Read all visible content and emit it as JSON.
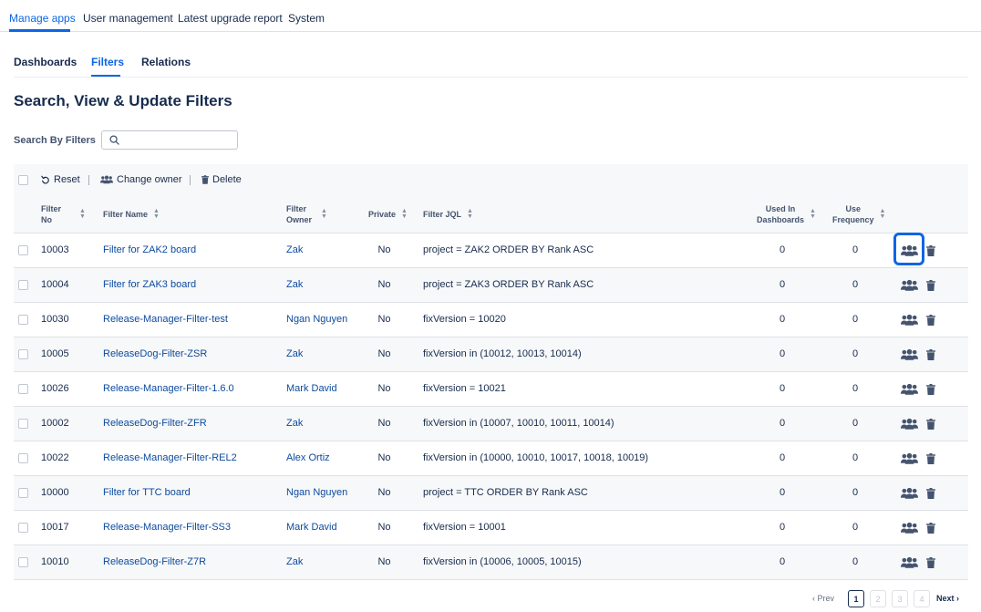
{
  "top_nav": {
    "tabs": [
      "Manage apps",
      "User management",
      "Latest upgrade report",
      "System"
    ],
    "active": "Manage apps"
  },
  "sub_nav": {
    "tabs": [
      "Dashboards",
      "Filters",
      "Relations"
    ],
    "active": "Filters"
  },
  "page_title": "Search, View & Update Filters",
  "search": {
    "label": "Search By Filters",
    "value": "",
    "placeholder": ""
  },
  "toolbar": {
    "reset": "Reset",
    "change_owner": "Change owner",
    "delete": "Delete"
  },
  "table": {
    "headers": {
      "filter_no": [
        "Filter",
        "No"
      ],
      "filter_name": "Filter Name",
      "filter_owner": [
        "Filter",
        "Owner"
      ],
      "private": "Private",
      "filter_jql": "Filter JQL",
      "used_in_dashboards": [
        "Used In",
        "Dashboards"
      ],
      "use_frequency": [
        "Use",
        "Frequency"
      ]
    },
    "rows": [
      {
        "no": "10003",
        "name": "Filter for ZAK2 board",
        "owner": "Zak",
        "private": "No",
        "jql": "project = ZAK2 ORDER BY Rank ASC",
        "dashboards": "0",
        "frequency": "0"
      },
      {
        "no": "10004",
        "name": "Filter for ZAK3 board",
        "owner": "Zak",
        "private": "No",
        "jql": "project = ZAK3 ORDER BY Rank ASC",
        "dashboards": "0",
        "frequency": "0"
      },
      {
        "no": "10030",
        "name": "Release-Manager-Filter-test",
        "owner": "Ngan Nguyen",
        "private": "No",
        "jql": "fixVersion = 10020",
        "dashboards": "0",
        "frequency": "0"
      },
      {
        "no": "10005",
        "name": "ReleaseDog-Filter-ZSR",
        "owner": "Zak",
        "private": "No",
        "jql": "fixVersion in (10012, 10013, 10014)",
        "dashboards": "0",
        "frequency": "0"
      },
      {
        "no": "10026",
        "name": "Release-Manager-Filter-1.6.0",
        "owner": "Mark David",
        "private": "No",
        "jql": "fixVersion = 10021",
        "dashboards": "0",
        "frequency": "0"
      },
      {
        "no": "10002",
        "name": "ReleaseDog-Filter-ZFR",
        "owner": "Zak",
        "private": "No",
        "jql": "fixVersion in (10007, 10010, 10011, 10014)",
        "dashboards": "0",
        "frequency": "0"
      },
      {
        "no": "10022",
        "name": "Release-Manager-Filter-REL2",
        "owner": "Alex Ortiz",
        "private": "No",
        "jql": "fixVersion in (10000, 10010, 10017, 10018, 10019)",
        "dashboards": "0",
        "frequency": "0"
      },
      {
        "no": "10000",
        "name": "Filter for TTC board",
        "owner": "Ngan Nguyen",
        "private": "No",
        "jql": "project = TTC ORDER BY Rank ASC",
        "dashboards": "0",
        "frequency": "0"
      },
      {
        "no": "10017",
        "name": "Release-Manager-Filter-SS3",
        "owner": "Mark David",
        "private": "No",
        "jql": "fixVersion = 10001",
        "dashboards": "0",
        "frequency": "0"
      },
      {
        "no": "10010",
        "name": "ReleaseDog-Filter-Z7R",
        "owner": "Zak",
        "private": "No",
        "jql": "fixVersion in (10006, 10005, 10015)",
        "dashboards": "0",
        "frequency": "0"
      }
    ]
  },
  "pagination": {
    "prev": "Prev",
    "next": "Next",
    "pages": [
      "1",
      "2",
      "3",
      "4"
    ],
    "current": "1"
  },
  "colors": {
    "accent": "#0c66e4",
    "link": "#0c4a9e",
    "text": "#172b4d",
    "icon": "#44546f"
  },
  "icons": {
    "reset": "undo-icon",
    "change_owner": "users-icon",
    "delete": "trash-icon",
    "search": "search-icon"
  }
}
